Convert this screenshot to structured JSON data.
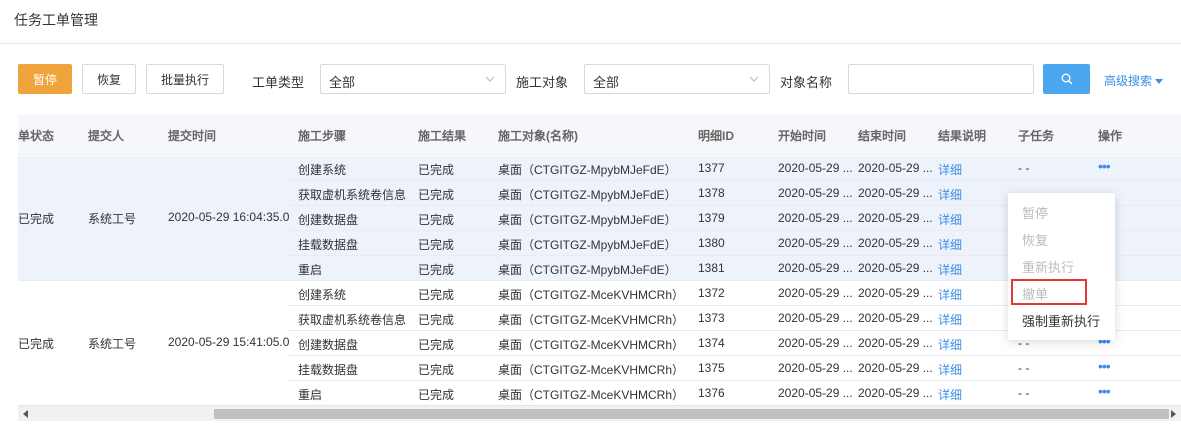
{
  "page": {
    "title": "任务工单管理"
  },
  "toolbar": {
    "pause_label": "暂停",
    "resume_label": "恢复",
    "batch_label": "批量执行",
    "ticket_type_label": "工单类型",
    "ticket_type_value": "全部",
    "target_label": "施工对象",
    "target_value": "全部",
    "object_name_label": "对象名称",
    "object_name_value": "",
    "advanced_search_label": "高级搜索"
  },
  "table": {
    "headers": [
      "单状态",
      "提交人",
      "提交时间",
      "施工步骤",
      "施工结果",
      "施工对象(名称)",
      "明细ID",
      "开始时间",
      "结束时间",
      "结果说明",
      "子任务",
      "操作"
    ],
    "groups": [
      {
        "status": "已完成",
        "submitter": "系统工号",
        "submit_time": "2020-05-29 16:04:35.0",
        "rows": [
          {
            "step": "创建系统",
            "result": "已完成",
            "target": "桌面（CTGITGZ-MpybMJeFdE）",
            "detail_id": "1377",
            "start": "2020-05-29 ...",
            "end": "2020-05-29 ...",
            "remark": "详细",
            "subtask": "- -",
            "op": "•••"
          },
          {
            "step": "获取虚机系统卷信息",
            "result": "已完成",
            "target": "桌面（CTGITGZ-MpybMJeFdE）",
            "detail_id": "1378",
            "start": "2020-05-29 ...",
            "end": "2020-05-29 ...",
            "remark": "详细",
            "subtask": "",
            "op": ""
          },
          {
            "step": "创建数据盘",
            "result": "已完成",
            "target": "桌面（CTGITGZ-MpybMJeFdE）",
            "detail_id": "1379",
            "start": "2020-05-29 ...",
            "end": "2020-05-29 ...",
            "remark": "详细",
            "subtask": "",
            "op": ""
          },
          {
            "step": "挂载数据盘",
            "result": "已完成",
            "target": "桌面（CTGITGZ-MpybMJeFdE）",
            "detail_id": "1380",
            "start": "2020-05-29 ...",
            "end": "2020-05-29 ...",
            "remark": "详细",
            "subtask": "",
            "op": ""
          },
          {
            "step": "重启",
            "result": "已完成",
            "target": "桌面（CTGITGZ-MpybMJeFdE）",
            "detail_id": "1381",
            "start": "2020-05-29 ...",
            "end": "2020-05-29 ...",
            "remark": "详细",
            "subtask": "",
            "op": ""
          }
        ]
      },
      {
        "status": "已完成",
        "submitter": "系统工号",
        "submit_time": "2020-05-29 15:41:05.0",
        "rows": [
          {
            "step": "创建系统",
            "result": "已完成",
            "target": "桌面（CTGITGZ-MceKVHMCRh）",
            "detail_id": "1372",
            "start": "2020-05-29 ...",
            "end": "2020-05-29 ...",
            "remark": "详细",
            "subtask": "",
            "op": ""
          },
          {
            "step": "获取虚机系统卷信息",
            "result": "已完成",
            "target": "桌面（CTGITGZ-MceKVHMCRh）",
            "detail_id": "1373",
            "start": "2020-05-29 ...",
            "end": "2020-05-29 ...",
            "remark": "详细",
            "subtask": "",
            "op": ""
          },
          {
            "step": "创建数据盘",
            "result": "已完成",
            "target": "桌面（CTGITGZ-MceKVHMCRh）",
            "detail_id": "1374",
            "start": "2020-05-29 ...",
            "end": "2020-05-29 ...",
            "remark": "详细",
            "subtask": "- -",
            "op": "•••"
          },
          {
            "step": "挂载数据盘",
            "result": "已完成",
            "target": "桌面（CTGITGZ-MceKVHMCRh）",
            "detail_id": "1375",
            "start": "2020-05-29 ...",
            "end": "2020-05-29 ...",
            "remark": "详细",
            "subtask": "- -",
            "op": "•••"
          },
          {
            "step": "重启",
            "result": "已完成",
            "target": "桌面（CTGITGZ-MceKVHMCRh）",
            "detail_id": "1376",
            "start": "2020-05-29 ...",
            "end": "2020-05-29 ...",
            "remark": "详细",
            "subtask": "- -",
            "op": "•••"
          }
        ]
      }
    ]
  },
  "action_menu": {
    "items": [
      "暂停",
      "恢复",
      "重新执行",
      "撤单",
      "强制重新执行"
    ]
  },
  "colors": {
    "primary_orange": "#f0a33a",
    "search_blue": "#4ba6f0",
    "link_blue": "#3a8ee6",
    "highlight_red": "#e53935"
  },
  "icons": {
    "search": "search-icon",
    "chevron": "chevron-down-icon",
    "more": "more-dots-icon"
  }
}
